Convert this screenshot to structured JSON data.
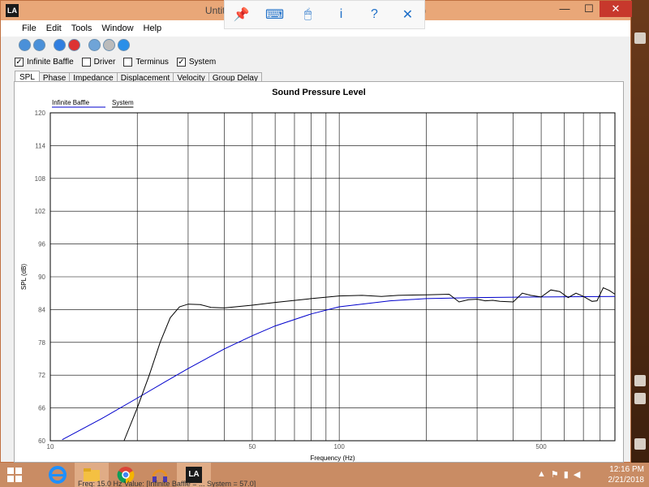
{
  "window": {
    "title": "Untitled - Leonard Audio - Transmission Line (Beta)",
    "logo": "LA",
    "min_glyph": "—",
    "max_glyph": "☐",
    "close_glyph": "✕"
  },
  "touchbar": {
    "icons": [
      "pin-icon",
      "keyboard-icon",
      "mouse-icon",
      "info-icon",
      "help-icon",
      "close-icon"
    ],
    "glyphs": [
      "📌",
      "⌨",
      "🖱",
      "i",
      "?",
      "✕"
    ]
  },
  "menu": [
    "File",
    "Edit",
    "Tools",
    "Window",
    "Help"
  ],
  "checks": [
    {
      "label": "Infinite Baffle",
      "checked": true
    },
    {
      "label": "Driver",
      "checked": false
    },
    {
      "label": "Terminus",
      "checked": false
    },
    {
      "label": "System",
      "checked": true
    }
  ],
  "tabs": [
    "SPL",
    "Phase",
    "Impedance",
    "Displacement",
    "Velocity",
    "Group Delay"
  ],
  "active_tab": "SPL",
  "status": "Freq: 15.0 Hz  Value: [Infinite Baffle = ... System = 57.0]",
  "tray": {
    "time": "12:16 PM",
    "date": "2/21/2018"
  },
  "chart_data": {
    "type": "line",
    "title": "Sound Pressure Level",
    "xlabel": "Frequency (Hz)",
    "ylabel": "SPL (dB)",
    "xscale": "log",
    "xlim": [
      10,
      900
    ],
    "ylim": [
      60,
      120
    ],
    "yticks": [
      60,
      66,
      72,
      78,
      84,
      90,
      96,
      102,
      108,
      114,
      120
    ],
    "xtick_labels": [
      {
        "v": 10,
        "t": "10"
      },
      {
        "v": 50,
        "t": "50"
      },
      {
        "v": 100,
        "t": "100"
      },
      {
        "v": 500,
        "t": "500"
      }
    ],
    "legend": "top-left",
    "series": [
      {
        "name": "Infinite Baffle",
        "color": "#0000cc",
        "x": [
          11,
          15,
          20,
          25,
          30,
          40,
          50,
          60,
          80,
          100,
          150,
          200,
          300,
          500,
          900
        ],
        "y": [
          60.2,
          64,
          67.8,
          70.8,
          73.2,
          76.8,
          79.2,
          81,
          83.2,
          84.5,
          85.6,
          86,
          86.2,
          86.3,
          86.4
        ]
      },
      {
        "name": "System",
        "color": "#000000",
        "x": [
          18,
          20,
          22,
          24,
          26,
          28,
          30,
          33,
          36,
          40,
          50,
          60,
          80,
          100,
          120,
          140,
          160,
          200,
          240,
          260,
          280,
          300,
          320,
          340,
          360,
          400,
          430,
          460,
          500,
          540,
          580,
          620,
          660,
          700,
          750,
          780,
          820,
          860,
          900
        ],
        "y": [
          60,
          66,
          72,
          78,
          82.5,
          84.5,
          85,
          84.9,
          84.4,
          84.3,
          84.8,
          85.3,
          86,
          86.5,
          86.6,
          86.4,
          86.6,
          86.7,
          86.8,
          85.4,
          85.8,
          85.9,
          85.6,
          85.7,
          85.5,
          85.4,
          87,
          86.6,
          86.3,
          87.6,
          87.3,
          86.2,
          87,
          86.4,
          85.5,
          85.6,
          88,
          87.5,
          86.8
        ]
      }
    ]
  }
}
